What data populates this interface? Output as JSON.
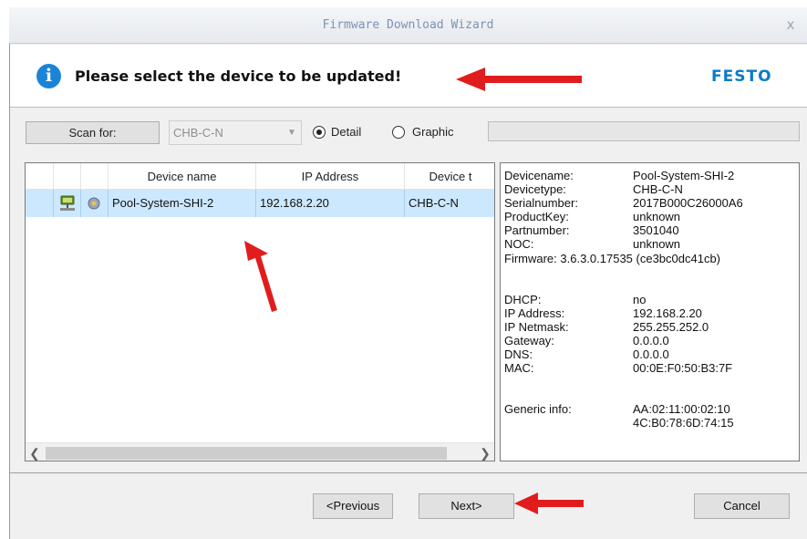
{
  "window": {
    "title": "Firmware Download Wizard",
    "close_glyph": "x"
  },
  "header": {
    "message": "Please select the device to be updated!",
    "brand": "FESTO",
    "icon": "info-icon"
  },
  "toolbar": {
    "scan_label": "Scan for:",
    "combo_value": "CHB-C-N",
    "radio_detail": "Detail",
    "radio_graphic": "Graphic",
    "selected_view": "Detail"
  },
  "grid": {
    "columns": [
      "",
      "",
      "",
      "Device name",
      "IP Address",
      "Device t"
    ],
    "rows": [
      {
        "device_name": "Pool-System-SHI-2",
        "ip": "192.168.2.20",
        "type": "CHB-C-N",
        "selected": true
      }
    ]
  },
  "details": {
    "items": [
      {
        "label": "Devicename:",
        "value": "Pool-System-SHI-2"
      },
      {
        "label": "Devicetype:",
        "value": "CHB-C-N"
      },
      {
        "label": "Serialnumber:",
        "value": "2017B000C26000A6"
      },
      {
        "label": "ProductKey:",
        "value": "unknown"
      },
      {
        "label": "Partnumber:",
        "value": "3501040"
      },
      {
        "label": "NOC:",
        "value": "unknown"
      }
    ],
    "firmware": "Firmware: 3.6.3.0.17535 (ce3bc0dc41cb)",
    "network": [
      {
        "label": "DHCP:",
        "value": "no"
      },
      {
        "label": "IP Address:",
        "value": "192.168.2.20"
      },
      {
        "label": "IP Netmask:",
        "value": "255.255.252.0"
      },
      {
        "label": "Gateway:",
        "value": "0.0.0.0"
      },
      {
        "label": "DNS:",
        "value": "0.0.0.0"
      },
      {
        "label": "MAC:",
        "value": "00:0E:F0:50:B3:7F"
      }
    ],
    "generic_label": "Generic info:",
    "generic_values": [
      "AA:02:11:00:02:10",
      "4C:B0:78:6D:74:15"
    ]
  },
  "buttons": {
    "previous": "<Previous",
    "next": "Next>",
    "cancel": "Cancel"
  },
  "colors": {
    "accent": "#1b84d6",
    "brand": "#0a7bc7",
    "selection": "#cce8ff",
    "annotation": "#e11c1c"
  }
}
